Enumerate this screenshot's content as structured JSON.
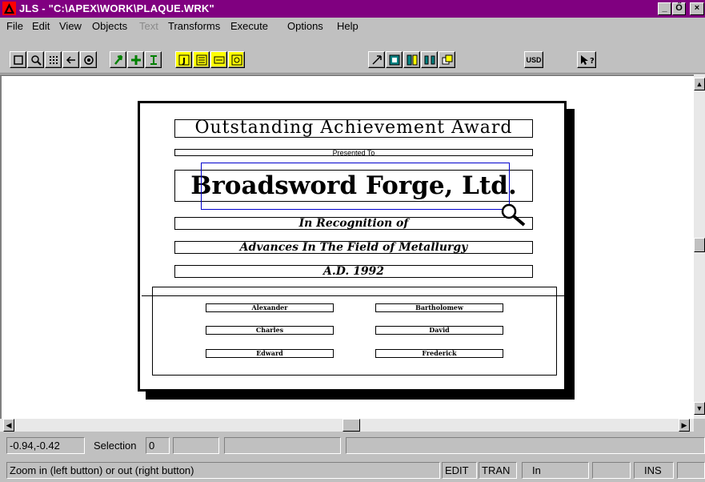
{
  "window": {
    "title": "JLS - \"C:\\APEX\\WORK\\PLAQUE.WRK\"",
    "minimize": "_",
    "restore": "Ő",
    "close": "×",
    "icon": "app-triangle-icon"
  },
  "menu": [
    "File",
    "Edit",
    "View",
    "Objects",
    "Text",
    "Transforms",
    "Execute",
    "Options",
    "Help"
  ],
  "toolbar": {
    "usd_label": "USD"
  },
  "plaque": {
    "title": "Outstanding Achievement Award",
    "presented": "Presented To",
    "company": "Broadsword Forge, Ltd.",
    "recognition": "In Recognition of",
    "field": "Advances In The Field of Metallurgy",
    "date": "A.D. 1992",
    "signers_left": [
      "Alexander",
      "Charles",
      "Edward"
    ],
    "signers_right": [
      "Bartholomew",
      "David",
      "Frederick"
    ]
  },
  "status": {
    "coords": "-0.94,-0.42",
    "selection_label": "Selection",
    "selection_value": "0",
    "hint": "Zoom in (left button) or out (right button)",
    "edit": "EDIT",
    "tran": "TRAN",
    "unit": "In",
    "ins": "INS"
  },
  "colors": {
    "titlebar": "#800080",
    "accent_yellow": "#ffff00",
    "accent_teal": "#008080",
    "zoom_rect": "#0000cc"
  }
}
